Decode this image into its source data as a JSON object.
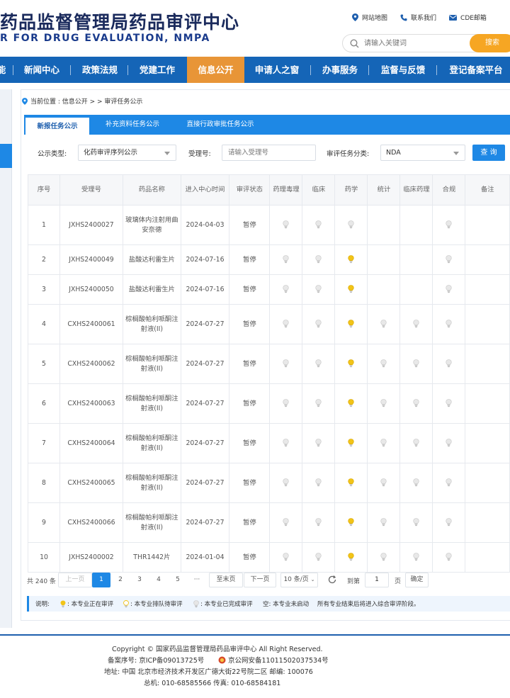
{
  "header": {
    "title_cn": "药品监督管理局药品审评中心",
    "title_en": "R FOR DRUG EVALUATION, NMPA",
    "links": [
      "网站地图",
      "联系我们",
      "CDE邮箱"
    ],
    "search_placeholder": "请输入关键词",
    "search_button": "搜索"
  },
  "nav": {
    "items": [
      "能",
      "新闻中心",
      "政策法规",
      "党建工作",
      "信息公开",
      "申请人之窗",
      "办事服务",
      "监督与反馈",
      "登记备案平台"
    ],
    "active": "信息公开"
  },
  "breadcrumb": "当前位置 : 信息公开 > > 审评任务公示",
  "tabs": [
    "新报任务公示",
    "补充资料任务公示",
    "直接行政审批任务公示"
  ],
  "filter": {
    "type_label": "公示类型:",
    "type_value": "化药审评序列公示",
    "accept_label": "受理号:",
    "accept_placeholder": "请输入受理号",
    "task_label": "审评任务分类:",
    "task_value": "NDA",
    "query_button": "查 询"
  },
  "table": {
    "headers": [
      "序号",
      "受理号",
      "药品名称",
      "进入中心时间",
      "审评状态",
      "药理毒理",
      "临床",
      "药学",
      "统计",
      "临床药理",
      "合规",
      "备注"
    ],
    "rows": [
      {
        "no": "1",
        "id": "JXHS2400027",
        "name": "玻璃体内注射用曲安奈德",
        "date": "2024-04-03",
        "status": "暂停",
        "marks": [
          "g",
          "g",
          "g",
          "",
          "",
          "g",
          ""
        ]
      },
      {
        "no": "2",
        "id": "JXHS2400049",
        "name": "盐酸达利雷生片",
        "date": "2024-07-16",
        "status": "暂停",
        "marks": [
          "g",
          "g",
          "y",
          "",
          "",
          "g",
          ""
        ]
      },
      {
        "no": "3",
        "id": "JXHS2400050",
        "name": "盐酸达利雷生片",
        "date": "2024-07-16",
        "status": "暂停",
        "marks": [
          "g",
          "g",
          "y",
          "",
          "",
          "g",
          ""
        ]
      },
      {
        "no": "4",
        "id": "CXHS2400061",
        "name": "棕榈酸帕利哌酮注射液(II)",
        "date": "2024-07-27",
        "status": "暂停",
        "marks": [
          "g",
          "g",
          "y",
          "g",
          "g",
          "g",
          ""
        ]
      },
      {
        "no": "5",
        "id": "CXHS2400062",
        "name": "棕榈酸帕利哌酮注射液(II)",
        "date": "2024-07-27",
        "status": "暂停",
        "marks": [
          "g",
          "g",
          "y",
          "g",
          "g",
          "g",
          ""
        ]
      },
      {
        "no": "6",
        "id": "CXHS2400063",
        "name": "棕榈酸帕利哌酮注射液(II)",
        "date": "2024-07-27",
        "status": "暂停",
        "marks": [
          "g",
          "g",
          "y",
          "g",
          "g",
          "g",
          ""
        ]
      },
      {
        "no": "7",
        "id": "CXHS2400064",
        "name": "棕榈酸帕利哌酮注射液(II)",
        "date": "2024-07-27",
        "status": "暂停",
        "marks": [
          "g",
          "g",
          "y",
          "g",
          "g",
          "g",
          ""
        ]
      },
      {
        "no": "8",
        "id": "CXHS2400065",
        "name": "棕榈酸帕利哌酮注射液(II)",
        "date": "2024-07-27",
        "status": "暂停",
        "marks": [
          "g",
          "g",
          "y",
          "g",
          "g",
          "g",
          ""
        ]
      },
      {
        "no": "9",
        "id": "CXHS2400066",
        "name": "棕榈酸帕利哌酮注射液(II)",
        "date": "2024-07-27",
        "status": "暂停",
        "marks": [
          "g",
          "g",
          "y",
          "g",
          "g",
          "g",
          ""
        ]
      },
      {
        "no": "10",
        "id": "JXHS2400002",
        "name": "THR1442片",
        "date": "2024-01-04",
        "status": "暂停",
        "marks": [
          "g",
          "g",
          "y",
          "g",
          "g",
          "g",
          ""
        ]
      }
    ]
  },
  "pager": {
    "total": "共 240 条",
    "prev": "上一页",
    "pages": [
      "1",
      "2",
      "3",
      "4",
      "5",
      "···"
    ],
    "last": "至末页",
    "next": "下一页",
    "size": "10 条/页",
    "goto_label": "到第",
    "goto_value": "1",
    "page_unit": "页",
    "confirm": "确定"
  },
  "legend": {
    "title": "说明:",
    "items": [
      ": 本专业正在审评",
      ": 本专业排队待审评",
      ": 本专业已完成审评"
    ],
    "empty": "空: 本专业未启动",
    "note": "所有专业结束后将进入综合审评阶段。"
  },
  "footer": {
    "copyright": "Copyright © 国家药品监督管理局药品审评中心   All Right Reserved.",
    "icp": "备案序号: 京ICP备09013725号",
    "police": "京公网安备11011502037534号",
    "address": "地址: 中国 北京市经济技术开发区广德大街22号院二区      邮编: 100076",
    "phone": "总机: 010-68585566      传真: 010-68584181"
  },
  "colors": {
    "nav_blue": "#1565b7",
    "nav_active": "#e89537",
    "accent_blue": "#1e88e5",
    "search_button": "#f6a623",
    "bulb_yellow": "#f2c418",
    "bulb_gray": "#d7d7d7"
  }
}
